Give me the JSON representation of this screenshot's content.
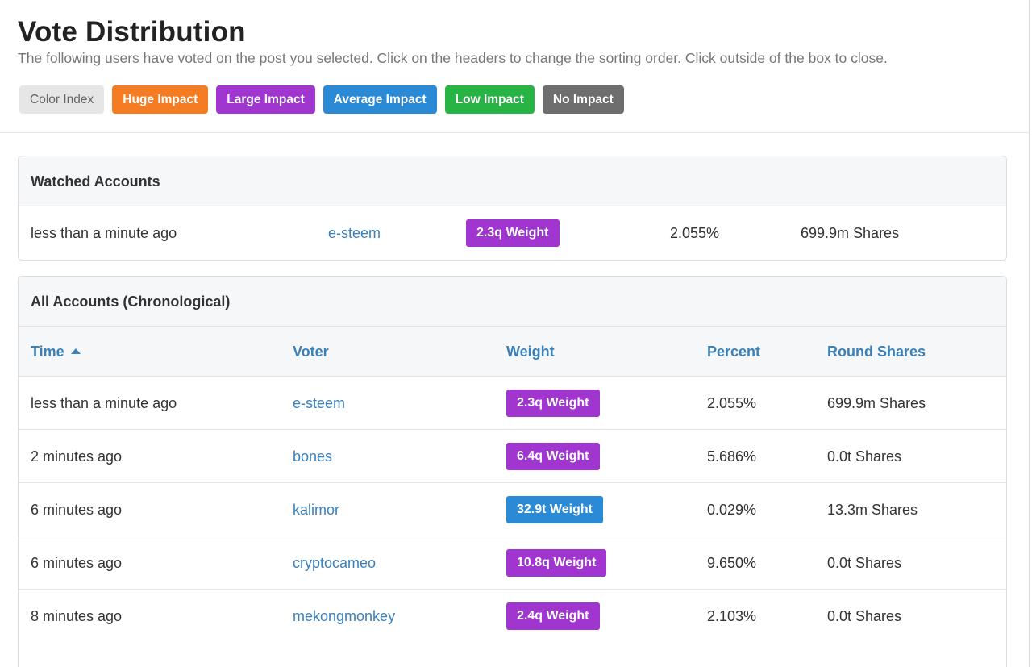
{
  "header": {
    "title": "Vote Distribution",
    "subtitle": "The following users have voted on the post you selected. Click on the headers to change the sorting order. Click outside of the box to close."
  },
  "legend": {
    "color_index": "Color Index",
    "huge": "Huge Impact",
    "large": "Large Impact",
    "average": "Average Impact",
    "low": "Low Impact",
    "none": "No Impact"
  },
  "watched": {
    "heading": "Watched Accounts",
    "row": {
      "time": "less than a minute ago",
      "voter": "e-steem",
      "weight": "2.3q Weight",
      "percent": "2.055%",
      "shares": "699.9m Shares"
    }
  },
  "all": {
    "heading": "All Accounts (Chronological)",
    "columns": {
      "time": "Time",
      "voter": "Voter",
      "weight": "Weight",
      "percent": "Percent",
      "shares": "Round Shares"
    },
    "rows": [
      {
        "time": "less than a minute ago",
        "voter": "e-steem",
        "weight": "2.3q Weight",
        "impact": "large",
        "percent": "2.055%",
        "shares": "699.9m Shares"
      },
      {
        "time": "2 minutes ago",
        "voter": "bones",
        "weight": "6.4q Weight",
        "impact": "large",
        "percent": "5.686%",
        "shares": "0.0t Shares"
      },
      {
        "time": "6 minutes ago",
        "voter": "kalimor",
        "weight": "32.9t Weight",
        "impact": "average",
        "percent": "0.029%",
        "shares": "13.3m Shares"
      },
      {
        "time": "6 minutes ago",
        "voter": "cryptocameo",
        "weight": "10.8q Weight",
        "impact": "large",
        "percent": "9.650%",
        "shares": "0.0t Shares"
      },
      {
        "time": "8 minutes ago",
        "voter": "mekongmonkey",
        "weight": "2.4q Weight",
        "impact": "large",
        "percent": "2.103%",
        "shares": "0.0t Shares"
      }
    ]
  },
  "colors": {
    "huge": "#f57c22",
    "large": "#a035cf",
    "average": "#2a8ad6",
    "low": "#27b444",
    "none": "#6e6e6e",
    "link": "#3a80b9"
  }
}
